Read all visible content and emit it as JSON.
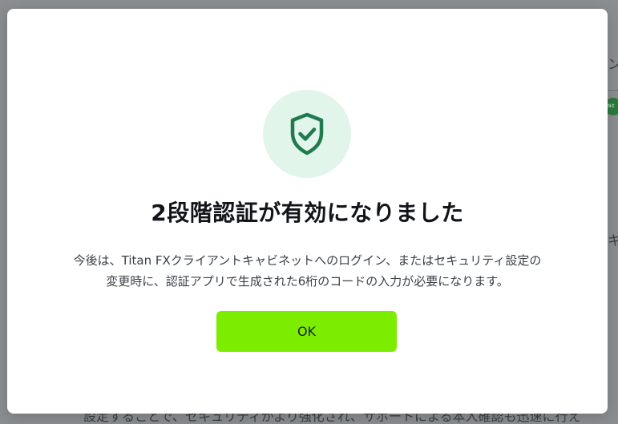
{
  "background": {
    "right_fragment_1": "ント",
    "right_fragment_2": "キ",
    "badge_text": "Nit",
    "bottom_text": "設定することで、セキュリティがより強化され、サポートによる本人確認も迅速に行え"
  },
  "modal": {
    "icon": "shield-check-icon",
    "title": "2段階認証が有効になりました",
    "description_line1": "今後は、Titan FXクライアントキャビネットへのログイン、またはセキュリティ設定の",
    "description_line2": "変更時に、認証アプリで生成された6桁のコードの入力が必要になります。",
    "ok_label": "OK"
  },
  "colors": {
    "accent_button": "#7ded00",
    "icon_circle_bg": "#e2f5ea",
    "icon_stroke": "#1f7a4f",
    "overlay": "#8b8e91"
  }
}
